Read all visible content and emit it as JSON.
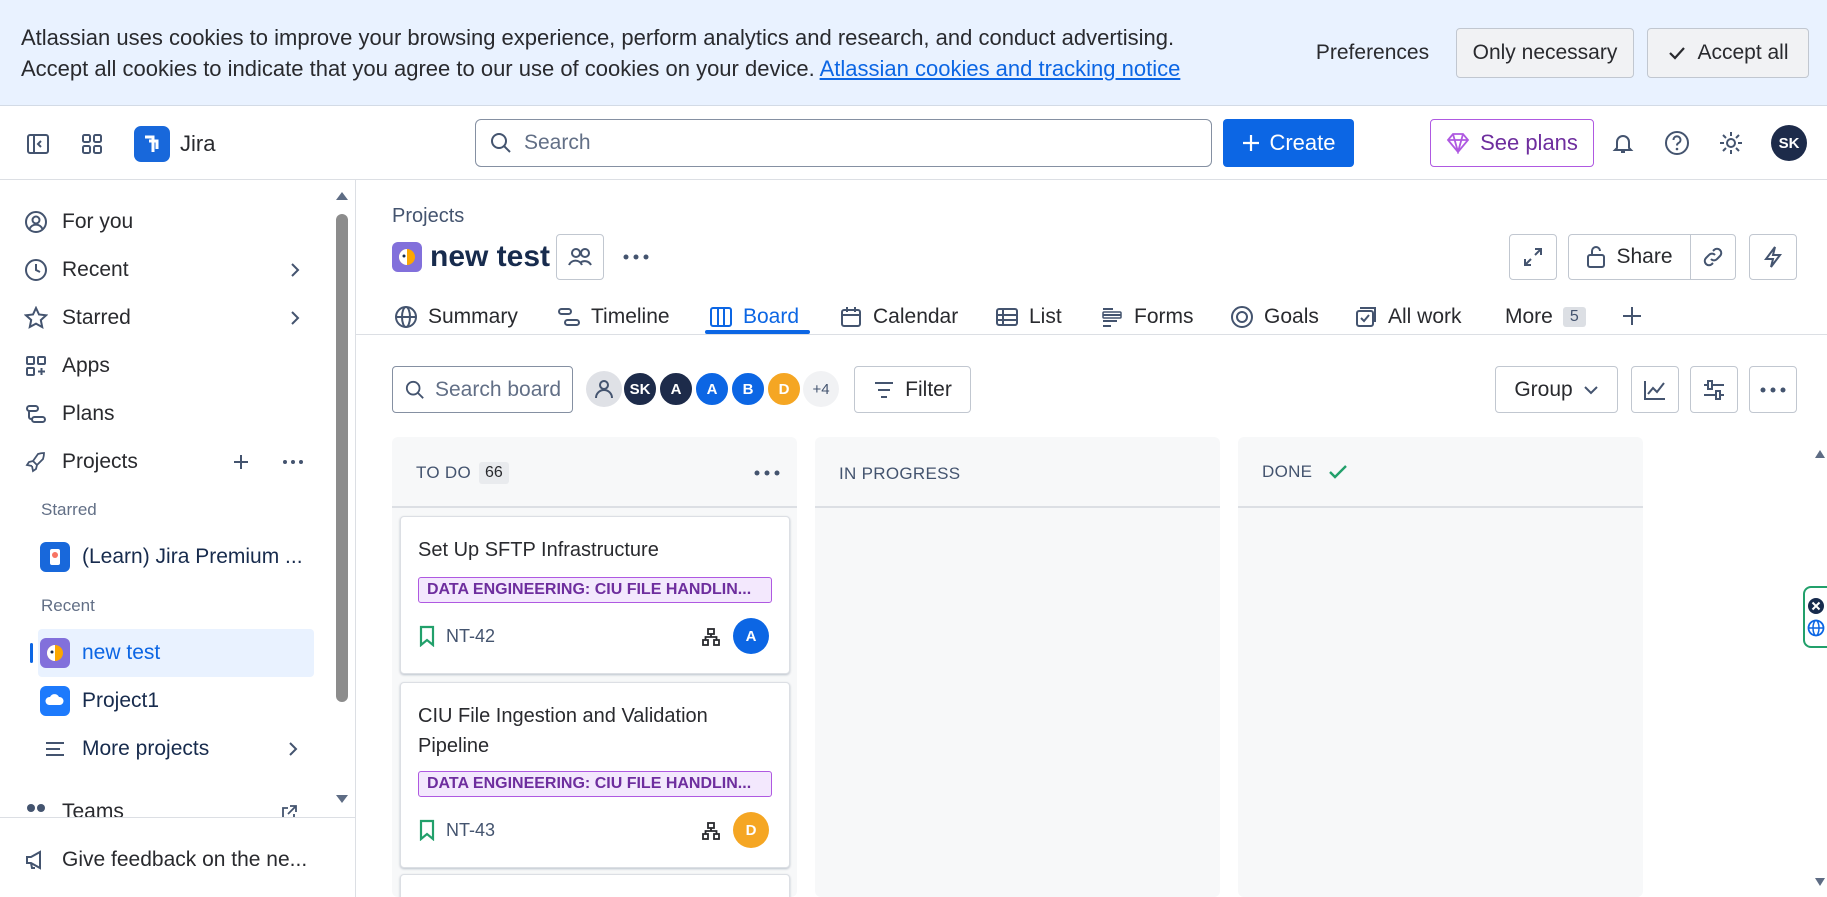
{
  "cookie_banner": {
    "text": "Atlassian uses cookies to improve your browsing experience, perform analytics and research, and conduct advertising. Accept all cookies to indicate that you agree to our use of cookies on your device.",
    "link": "Atlassian cookies and tracking notice",
    "preferences": "Preferences",
    "only_necessary": "Only necessary",
    "accept_all": "Accept all"
  },
  "topbar": {
    "app_name": "Jira",
    "search_placeholder": "Search",
    "create_label": "Create",
    "see_plans_label": "See plans",
    "user_initials": "SK"
  },
  "sidebar": {
    "for_you": "For you",
    "recent": "Recent",
    "starred": "Starred",
    "apps": "Apps",
    "plans": "Plans",
    "projects": "Projects",
    "starred_heading": "Starred",
    "starred_project": "(Learn) Jira Premium ...",
    "recent_heading": "Recent",
    "recent_projects": [
      "new test",
      "Project1"
    ],
    "more_projects": "More projects",
    "teams": "Teams",
    "feedback": "Give feedback on the ne..."
  },
  "project": {
    "breadcrumb": "Projects",
    "name": "new test",
    "share_label": "Share"
  },
  "tabs": {
    "summary": "Summary",
    "timeline": "Timeline",
    "board": "Board",
    "calendar": "Calendar",
    "list": "List",
    "forms": "Forms",
    "goals": "Goals",
    "all_work": "All work",
    "more": "More",
    "more_count": "5"
  },
  "board_toolbar": {
    "search_placeholder": "Search board",
    "avatars": [
      "SK",
      "A",
      "A",
      "B",
      "D"
    ],
    "avatar_colors": [
      "#1d2b4a",
      "#1d2b4a",
      "#0c66e4",
      "#0c66e4",
      "#f5a623"
    ],
    "more_avatars": "+4",
    "filter_label": "Filter",
    "group_label": "Group"
  },
  "columns": {
    "todo": {
      "title": "TO DO",
      "count": "66"
    },
    "in_progress": {
      "title": "IN PROGRESS"
    },
    "done": {
      "title": "DONE"
    }
  },
  "cards": [
    {
      "title": "Set Up SFTP Infrastructure",
      "epic": "DATA ENGINEERING: CIU FILE HANDLIN...",
      "key": "NT-42",
      "assignee": "A",
      "assignee_color": "#0c66e4"
    },
    {
      "title": "CIU File Ingestion and Validation Pipeline",
      "epic": "DATA ENGINEERING: CIU FILE HANDLIN...",
      "key": "NT-43",
      "assignee": "D",
      "assignee_color": "#f5a623"
    }
  ]
}
